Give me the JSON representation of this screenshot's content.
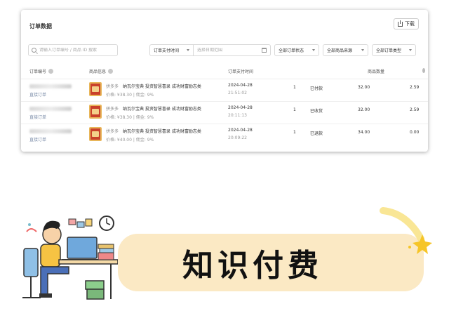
{
  "card": {
    "title": "订单数据",
    "download_label": "下载"
  },
  "filters": {
    "search_placeholder": "请输入订单编号 / 商品 ID 搜索",
    "time_type": "订单支付时间",
    "date_placeholder": "选择日期范围",
    "status": "全部订单状态",
    "source": "全部商品来源",
    "order_type": "全部订单类型"
  },
  "table": {
    "headers": [
      "订单编号",
      "商品信息",
      "订单支付时间",
      "商品数量"
    ],
    "rows": [
      {
        "type": "直接订单",
        "shop": "拼多多",
        "name": "纳瓦尔宝典 投资智慧喜录 成功财富励志类",
        "price": "价格: ¥38.30 | 佣金: 9%",
        "date": "2024-04-28",
        "time": "21:51:02",
        "qty": "1",
        "status": "已付款",
        "amount": "32.00",
        "commission": "2.59"
      },
      {
        "type": "直接订单",
        "shop": "拼多多",
        "name": "纳瓦尔宝典 投资智慧喜录 成功财富励志类",
        "price": "价格: ¥38.30 | 佣金: 9%",
        "date": "2024-04-28",
        "time": "20:11:13",
        "qty": "1",
        "status": "已收货",
        "amount": "32.00",
        "commission": "2.59"
      },
      {
        "type": "直接订单",
        "shop": "拼多多",
        "name": "纳瓦尔宝典 投资智慧喜录 成功财富励志类",
        "price": "价格: ¥40.00 | 佣金: 9%",
        "date": "2024-04-28",
        "time": "20:09:22",
        "qty": "1",
        "status": "已退款",
        "amount": "34.00",
        "commission": "0.00"
      }
    ]
  },
  "banner": {
    "text": "知识付费"
  }
}
